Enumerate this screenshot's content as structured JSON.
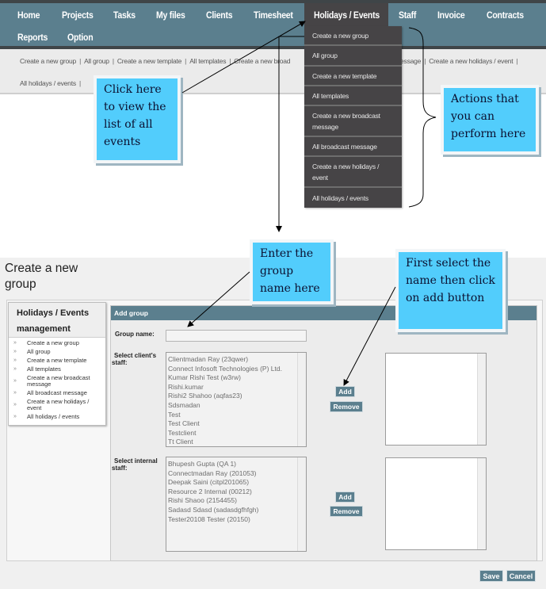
{
  "topnav": {
    "items": [
      "Home",
      "Projects",
      "Tasks",
      "My files",
      "Clients",
      "Timesheet",
      "Holidays / Events",
      "Staff",
      "Invoice",
      "Contracts",
      "Reports",
      "Option"
    ],
    "active": "Holidays / Events"
  },
  "dropdown": {
    "items": [
      "Create a new group",
      "All group",
      "Create a new template",
      "All templates",
      "Create a new broadcast message",
      "All broadcast message",
      "Create a new holidays / event",
      "All holidays / events"
    ]
  },
  "subnav": {
    "items": [
      "Create a new group",
      "All group",
      "Create a new template",
      "All templates",
      "Create a new broadcast message",
      "All broadcast message",
      "Create a new holidays / event",
      "All holidays / events"
    ],
    "visible_fragments": {
      "broad": "Create a new broad",
      "essage": "essage"
    }
  },
  "callouts": {
    "click_here": "Click here to view the list of all events",
    "actions": "Actions that you can perform here",
    "enter_group": "Enter the group name here",
    "first_select": "First select the name then click on add button"
  },
  "page": {
    "title": "Create a new group"
  },
  "side_menu": {
    "title": "Holidays / Events management",
    "chevron": "»",
    "items": [
      "Create a new group",
      "All group",
      "Create a new template",
      "All templates",
      "Create a new broadcast message",
      "All broadcast message",
      "Create a new holidays / event",
      "All holidays / events"
    ]
  },
  "form": {
    "header": "Add group",
    "group_name_label": "Group name:",
    "group_name_value": "",
    "client_staff_label": "Select client's staff:",
    "client_staff_options": [
      "Clientmadan Ray (23qwer)",
      "Connect Infosoft Technologies (P) Ltd.",
      "Kumar Rishi Test (w3rw)",
      "Rishi.kumar",
      "Rishi2 Shahoo (aqfas23)",
      "Sdsmadan",
      "Test",
      "Test Client",
      "Testclient",
      "Tt Client"
    ],
    "internal_staff_label": "Select internal staff:",
    "internal_staff_options": [
      "Bhupesh Gupta (QA 1)",
      "Connectmadan Ray (201053)",
      "Deepak Saini (citpl201065)",
      "Resource 2 Internal (00212)",
      "Rishi Shaoo (2154455)",
      "Sadasd Sdasd (sadasdgfhfgh)",
      "Tester20108 Tester (20150)"
    ],
    "add_label": "Add",
    "remove_label": "Remove",
    "save_label": "Save",
    "cancel_label": "Cancel"
  },
  "colors": {
    "nav_bg": "#5b7f8e",
    "nav_active": "#464446",
    "callout_bg": "#52cdfc",
    "button_bg": "#5b7f8e"
  }
}
